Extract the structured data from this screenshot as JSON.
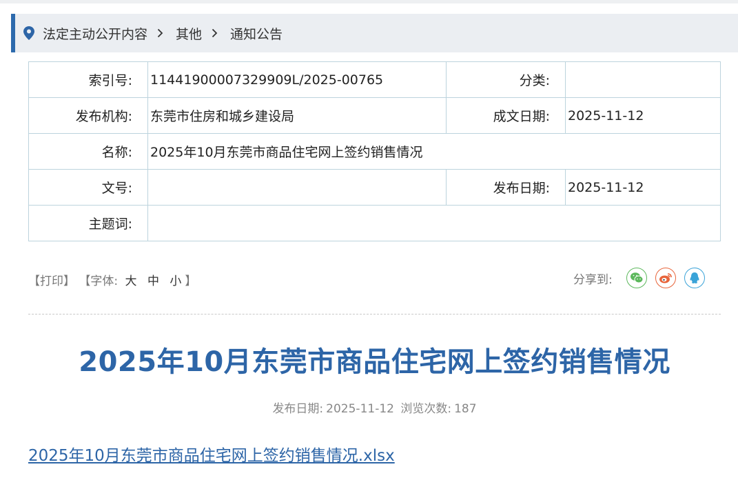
{
  "breadcrumb": {
    "items": [
      "法定主动公开内容",
      "其他",
      "通知公告"
    ],
    "separator": "›"
  },
  "meta": {
    "index_label": "索引号:",
    "index_value": "11441900007329909L/2025-00765",
    "category_label": "分类:",
    "category_value": "",
    "publisher_label": "发布机构:",
    "publisher_value": "东莞市住房和城乡建设局",
    "created_label": "成文日期:",
    "created_value": "2025-11-12",
    "name_label": "名称:",
    "name_value": "2025年10月东莞市商品住宅网上签约销售情况",
    "docno_label": "文号:",
    "docno_value": "",
    "pubdate_label": "发布日期:",
    "pubdate_value": "2025-11-12",
    "keywords_label": "主题词:",
    "keywords_value": ""
  },
  "tools": {
    "print": "【打印】",
    "font_prefix": "【字体:",
    "font_large": "大",
    "font_medium": "中",
    "font_small": "小",
    "font_suffix": "】",
    "share_label": "分享到:"
  },
  "share_icons": [
    {
      "name": "wechat-icon",
      "color": "#5cb85c"
    },
    {
      "name": "weibo-icon",
      "color": "#e8643a"
    },
    {
      "name": "qq-icon",
      "color": "#3aa3d8"
    }
  ],
  "article": {
    "title": "2025年10月东莞市商品住宅网上签约销售情况",
    "date_label": "发布日期:",
    "date_value": "2025-11-12",
    "views_label": "浏览次数:",
    "views_value": "187",
    "attachment": "2025年10月东莞市商品住宅网上签约销售情况.xlsx"
  },
  "colors": {
    "accent": "#2d65a7",
    "breadcrumb_bg": "#ebeef2",
    "table_border": "#bcd3dd"
  }
}
